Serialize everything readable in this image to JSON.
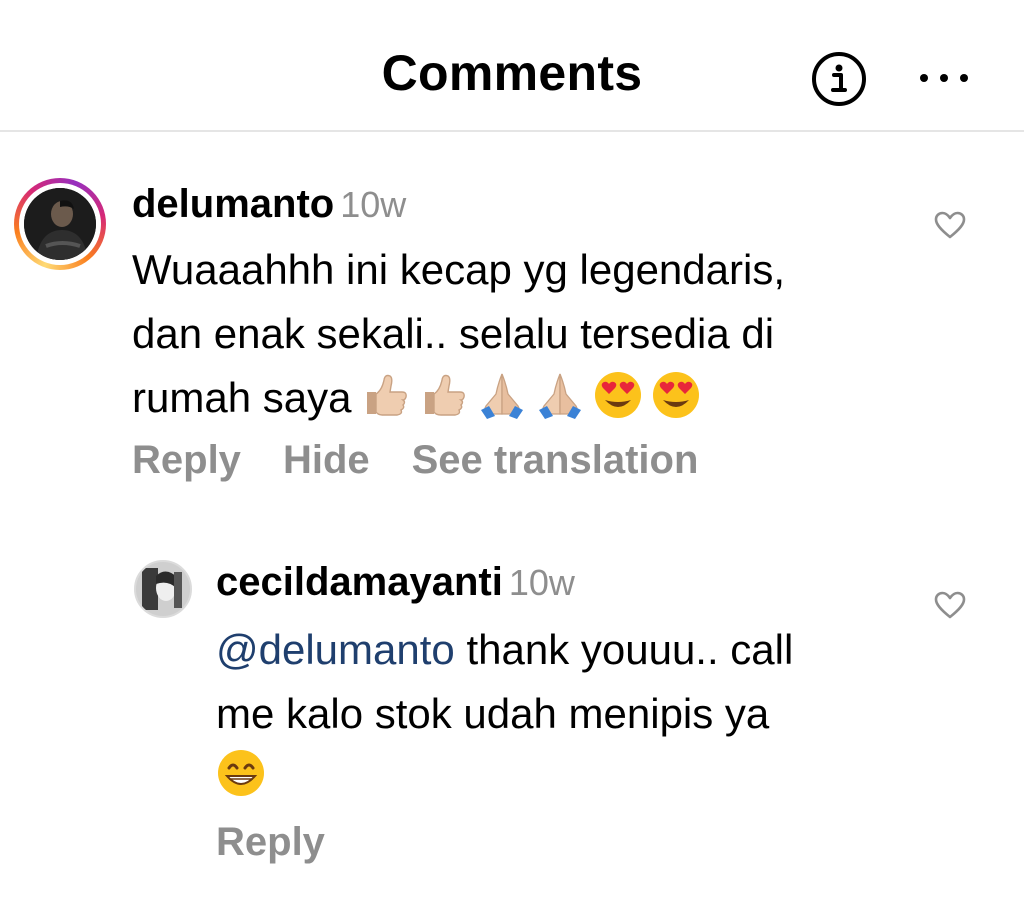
{
  "header": {
    "title": "Comments",
    "info_icon": "info-circle-icon",
    "more_icon": "more-horizontal-icon"
  },
  "comments": [
    {
      "username": "delumanto",
      "time": "10w",
      "text_lines": [
        "Wuaaahhh ini kecap yg legendaris,",
        "dan enak sekali.. selalu tersedia di",
        "rumah saya"
      ],
      "emojis": [
        "thumbs-up",
        "thumbs-up",
        "folded-hands",
        "folded-hands",
        "heart-eyes",
        "heart-eyes"
      ],
      "actions": [
        "Reply",
        "Hide",
        "See translation"
      ],
      "like_icon": "heart-outline-icon"
    }
  ],
  "reply": {
    "username": "cecildamayanti",
    "time": "10w",
    "mention": "@delumanto",
    "text_lines": [
      " thank youuu.. call",
      "me kalo stok udah menipis ya"
    ],
    "emojis": [
      "grinning-face"
    ],
    "actions": [
      "Reply"
    ],
    "like_icon": "heart-outline-icon"
  },
  "colors": {
    "secondary_text": "#8e8e8e",
    "mention": "#1f3f6e",
    "divider": "#e5e5e5"
  }
}
